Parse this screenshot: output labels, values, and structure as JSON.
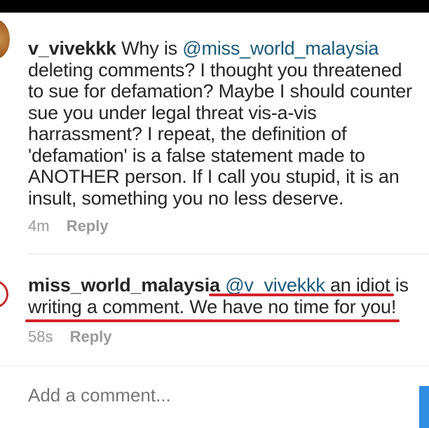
{
  "comments": [
    {
      "username": "v_vivekkk",
      "mention_prefix": " Why is ",
      "mention": "@miss_world_malaysia",
      "text": " deleting comments? I thought you threatened to sue for defamation? Maybe I should counter sue you under legal threat vis-a-vis harrassment? I repeat, the definition of 'defamation' is a false statement made to ANOTHER person. If I call you stupid, it is an insult, something you no less deserve.",
      "time": "4m",
      "reply_label": "Reply"
    },
    {
      "username": "miss_world_malaysia",
      "mention_prefix": " ",
      "mention": "@v_vivekkk",
      "text": " an idiot is writing a comment. We have no time for you!",
      "time": "58s",
      "reply_label": "Reply"
    }
  ],
  "composer": {
    "placeholder": "Add a comment..."
  },
  "colors": {
    "mention": "#1a5a7a",
    "annotation_underline": "#d4232b",
    "post_button": "#2f8de4"
  }
}
